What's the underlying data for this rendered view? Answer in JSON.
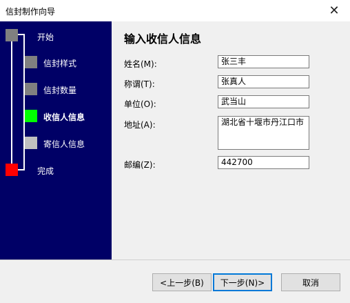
{
  "window": {
    "title": "信封制作向导",
    "close_label": "✕"
  },
  "steps": [
    {
      "label": "开始",
      "color": "#808080"
    },
    {
      "label": "信封样式",
      "color": "#808080"
    },
    {
      "label": "信封数量",
      "color": "#808080"
    },
    {
      "label": "收信人信息",
      "color": "#00ff00"
    },
    {
      "label": "寄信人信息",
      "color": "#c0c0c0"
    },
    {
      "label": "完成",
      "color": "#ff0000"
    }
  ],
  "page": {
    "heading": "输入收信人信息",
    "fields": {
      "name": {
        "label": "姓名(M):",
        "value": "张三丰"
      },
      "title": {
        "label": "称谓(T):",
        "value": "张真人"
      },
      "company": {
        "label": "单位(O):",
        "value": "武当山"
      },
      "address": {
        "label": "地址(A):",
        "value": "湖北省十堰市丹江口市"
      },
      "zip": {
        "label": "邮编(Z):",
        "value": "442700"
      }
    }
  },
  "buttons": {
    "back": "<上一步(B)",
    "next": "下一步(N)>",
    "cancel": "取消"
  }
}
